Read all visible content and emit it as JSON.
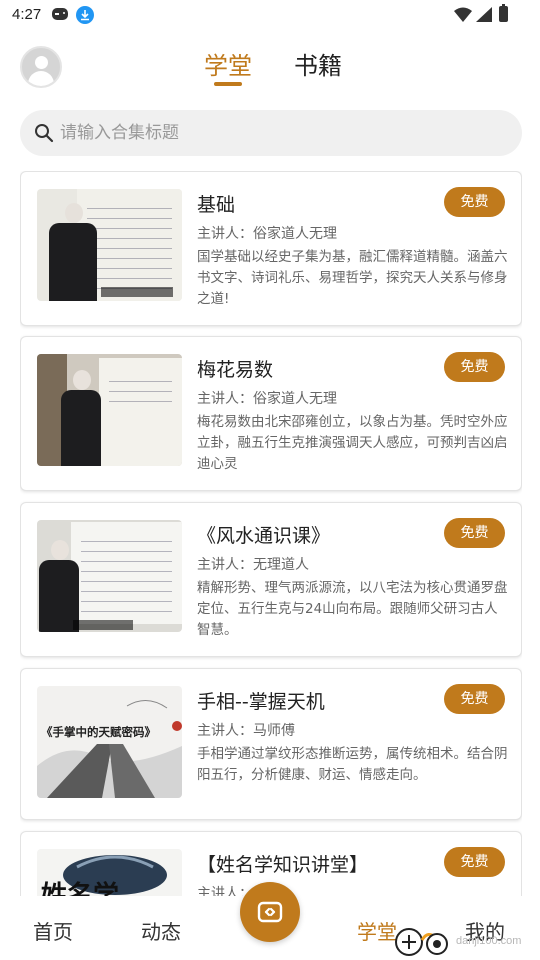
{
  "status_bar": {
    "time": "4:27",
    "icons": [
      "gamepad-icon",
      "download-icon",
      "wifi-icon",
      "signal-icon",
      "battery-icon"
    ]
  },
  "header": {
    "tabs": [
      {
        "label": "学堂",
        "active": true
      },
      {
        "label": "书籍",
        "active": false
      }
    ],
    "accent_color": "#c07a1c"
  },
  "search": {
    "placeholder": "请输入合集标题",
    "value": ""
  },
  "courses": [
    {
      "title": "基础",
      "badge": "免费",
      "lecturer": "主讲人：俗家道人无理",
      "description": "国学基础以经史子集为基，融汇儒释道精髓。涵盖六书文字、诗词礼乐、易理哲学，探究天人关系与修身之道!"
    },
    {
      "title": "梅花易数",
      "badge": "免费",
      "lecturer": "主讲人：俗家道人无理",
      "description": "梅花易数由北宋邵雍创立，以象占为基。凭时空外应立卦，融五行生克推演强调天人感应，可预判吉凶启迪心灵"
    },
    {
      "title": "《风水通识课》",
      "badge": "免费",
      "lecturer": "主讲人：无理道人",
      "description": "精解形势、理气两派源流，以八宅法为核心贯通罗盘定位、五行生克与24山向布局。跟随师父研习古人智慧。"
    },
    {
      "title": "手相--掌握天机",
      "badge": "免费",
      "lecturer": "主讲人：马师傅",
      "description": "手相学通过掌纹形态推断运势，属传统相术。结合阴阳五行，分析健康、财运、情感走向。",
      "thumb_text": "《手掌中的天赋密码》"
    },
    {
      "title": "【姓名学知识讲堂】",
      "badge": "免费",
      "lecturer": "主讲人：",
      "description": "",
      "thumb_text": "姓名学"
    }
  ],
  "bottom_nav": {
    "items": [
      {
        "label": "首页",
        "active": false
      },
      {
        "label": "动态",
        "active": false
      },
      {
        "label": "学堂",
        "active": true
      },
      {
        "label": "我的",
        "active": false
      }
    ],
    "center_icon": "live-icon"
  },
  "watermark": {
    "text": "danji100.com"
  }
}
